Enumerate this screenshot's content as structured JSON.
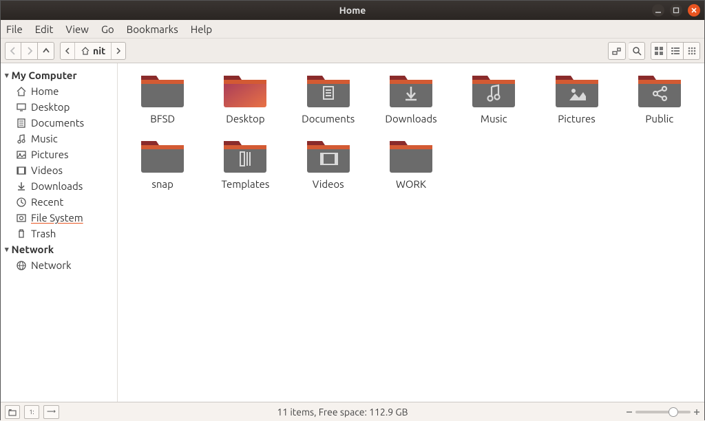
{
  "titlebar": {
    "title": "Home"
  },
  "menu": {
    "items": [
      "File",
      "Edit",
      "View",
      "Go",
      "Bookmarks",
      "Help"
    ]
  },
  "path": {
    "current": "nit"
  },
  "sidebar": {
    "sections": [
      {
        "label": "My Computer",
        "items": [
          {
            "icon": "home",
            "label": "Home"
          },
          {
            "icon": "desktop",
            "label": "Desktop"
          },
          {
            "icon": "doc",
            "label": "Documents"
          },
          {
            "icon": "music",
            "label": "Music"
          },
          {
            "icon": "image",
            "label": "Pictures"
          },
          {
            "icon": "video",
            "label": "Videos"
          },
          {
            "icon": "download",
            "label": "Downloads"
          },
          {
            "icon": "recent",
            "label": "Recent"
          },
          {
            "icon": "disk",
            "label": "File System",
            "selected": true
          },
          {
            "icon": "trash",
            "label": "Trash"
          }
        ]
      },
      {
        "label": "Network",
        "items": [
          {
            "icon": "globe",
            "label": "Network"
          }
        ]
      }
    ]
  },
  "folders": [
    {
      "name": "BFSD",
      "icon": "plain"
    },
    {
      "name": "Desktop",
      "icon": "desktop"
    },
    {
      "name": "Documents",
      "icon": "doc"
    },
    {
      "name": "Downloads",
      "icon": "download"
    },
    {
      "name": "Music",
      "icon": "music"
    },
    {
      "name": "Pictures",
      "icon": "image"
    },
    {
      "name": "Public",
      "icon": "share"
    },
    {
      "name": "snap",
      "icon": "plain"
    },
    {
      "name": "Templates",
      "icon": "template"
    },
    {
      "name": "Videos",
      "icon": "video"
    },
    {
      "name": "WORK",
      "icon": "plain"
    }
  ],
  "status": {
    "text": "11 items, Free space: 112.9 GB"
  }
}
